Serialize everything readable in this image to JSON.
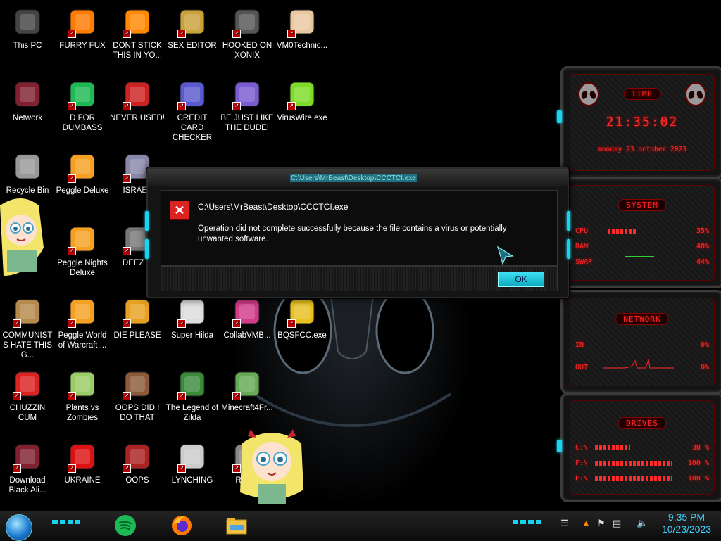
{
  "desktop": {
    "icons": [
      {
        "label": "This PC",
        "icon": "this-pc-icon"
      },
      {
        "label": "FURRY FUX",
        "icon": "firefox-icon"
      },
      {
        "label": "DONT STICK THIS IN YO...",
        "icon": "vlc-cone-icon"
      },
      {
        "label": "SEX EDITOR",
        "icon": "hxd-editor-icon"
      },
      {
        "label": "HOOKED ON XONIX",
        "icon": "xonix-game-icon"
      },
      {
        "label": "VM0Technic...",
        "icon": "technician-icon"
      },
      {
        "label": "Network",
        "icon": "network-alien-icon"
      },
      {
        "label": "D FOR DUMBASS",
        "icon": "spotify-icon"
      },
      {
        "label": "NEVER USED!",
        "icon": "dev-cpp-icon"
      },
      {
        "label": "CREDIT CARD CHECKER",
        "icon": "credit-card-icon"
      },
      {
        "label": "BE JUST LIKE THE DUDE!",
        "icon": "bonzi-icon"
      },
      {
        "label": "VirusWire.exe",
        "icon": "limewire-icon"
      },
      {
        "label": "Recycle Bin",
        "icon": "recycle-bin-icon"
      },
      {
        "label": "Peggle Deluxe",
        "icon": "peggle-icon"
      },
      {
        "label": "ISRAEL",
        "icon": "network-share-icon"
      },
      {
        "label": "nel",
        "icon": "control-panel-icon"
      },
      {
        "label": "Peggle Nights Deluxe",
        "icon": "peggle-icon"
      },
      {
        "label": "DEEZ N",
        "icon": "stacked-windows-icon"
      },
      {
        "label": "COMMUNISTS HATE THIS G...",
        "icon": "money-bag-icon"
      },
      {
        "label": "Peggle World of Warcraft ...",
        "icon": "peggle-icon"
      },
      {
        "label": "DIE PLEASE",
        "icon": "de-app-icon"
      },
      {
        "label": "Super Hilda",
        "icon": "hilda-icon"
      },
      {
        "label": "CollabVMB...",
        "icon": "collabvm-icon"
      },
      {
        "label": "BQSFCC.exe",
        "icon": "padlock-icon"
      },
      {
        "label": "CHUZZIN CUM",
        "icon": "chuzzle-icon"
      },
      {
        "label": "Plants vs Zombies",
        "icon": "pvz-icon"
      },
      {
        "label": "OOPS DID I DO THAT",
        "icon": "portrait-icon"
      },
      {
        "label": "The Legend of Zilda",
        "icon": "zelda-icon"
      },
      {
        "label": "Minecraft4Fr...",
        "icon": "minecraft-icon"
      },
      {
        "label": "Download Black Ali...",
        "icon": "alien-ware-icon"
      },
      {
        "label": "UKRAINE",
        "icon": "radiation-icon"
      },
      {
        "label": "OOPS",
        "icon": "oops-terminal-icon"
      },
      {
        "label": "LYNCHING",
        "icon": "lynch-icon"
      },
      {
        "label": "Ranso",
        "icon": "ransom-icon"
      }
    ]
  },
  "dialog": {
    "title": "C:\\Users\\MrBeast\\Desktop\\CCCTCI.exe",
    "heading": "C:\\Users\\MrBeast\\Desktop\\CCCTCI.exe",
    "message": "Operation did not complete successfully because the file contains a virus or potentially unwanted software.",
    "ok_label": "OK",
    "error_icon": "error-x-icon"
  },
  "gadgets": {
    "time": {
      "title": "TIME",
      "time": "21:35:02",
      "date": "monday 23 october 2023"
    },
    "system": {
      "title": "SYSTEM",
      "rows": [
        {
          "name": "CPU",
          "value": "35%"
        },
        {
          "name": "RAM",
          "value": "48%"
        },
        {
          "name": "SWAP",
          "value": "44%"
        }
      ]
    },
    "network": {
      "title": "NETWORK",
      "rows": [
        {
          "name": "IN",
          "value": "0%"
        },
        {
          "name": "OUT",
          "value": "0%"
        }
      ]
    },
    "drives": {
      "title": "DRIVES",
      "rows": [
        {
          "name": "C:\\",
          "value": "38 %"
        },
        {
          "name": "F:\\",
          "value": "100 %"
        },
        {
          "name": "E:\\",
          "value": "100 %"
        }
      ]
    }
  },
  "taskbar": {
    "clock_time": "9:35 PM",
    "clock_date": "10/23/2023",
    "pinned": [
      "spotify-icon",
      "firefox-icon",
      "file-explorer-icon"
    ],
    "tray": [
      "action-center-icon",
      "sticky-icon",
      "flag-icon",
      "network-icon",
      "volume-icon"
    ]
  },
  "colors": {
    "accent_cyan": "#19d3ef",
    "gadget_red": "#ff2a2a",
    "clock_blue": "#3ad0ff"
  }
}
